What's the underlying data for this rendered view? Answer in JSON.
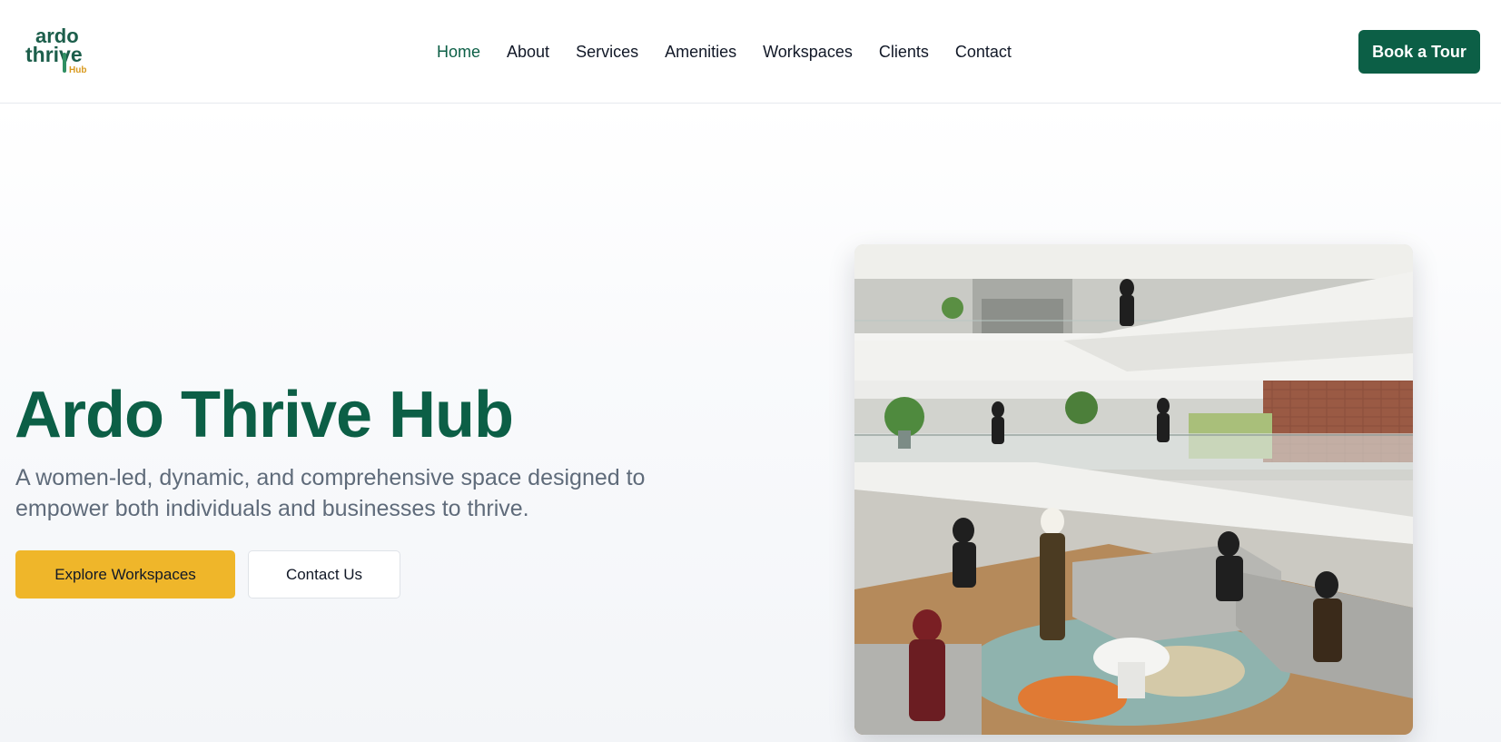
{
  "brand": {
    "logo_line1": "ardo",
    "logo_line2": "thrive",
    "logo_line3": "Hub",
    "primary_color": "#0c5f46",
    "accent_color": "#efb62a"
  },
  "nav": {
    "items": [
      {
        "label": "Home",
        "active": true
      },
      {
        "label": "About",
        "active": false
      },
      {
        "label": "Services",
        "active": false
      },
      {
        "label": "Amenities",
        "active": false
      },
      {
        "label": "Workspaces",
        "active": false
      },
      {
        "label": "Clients",
        "active": false
      },
      {
        "label": "Contact",
        "active": false
      }
    ],
    "cta_label": "Book a Tour"
  },
  "hero": {
    "title": "Ardo Thrive Hub",
    "subtitle": "A women-led, dynamic, and comprehensive space designed to empower both individuals and businesses to thrive.",
    "primary_button": "Explore Workspaces",
    "secondary_button": "Contact Us",
    "image_subject": "multi-level coworking atrium with women working on sofas and mezzanine floors"
  }
}
